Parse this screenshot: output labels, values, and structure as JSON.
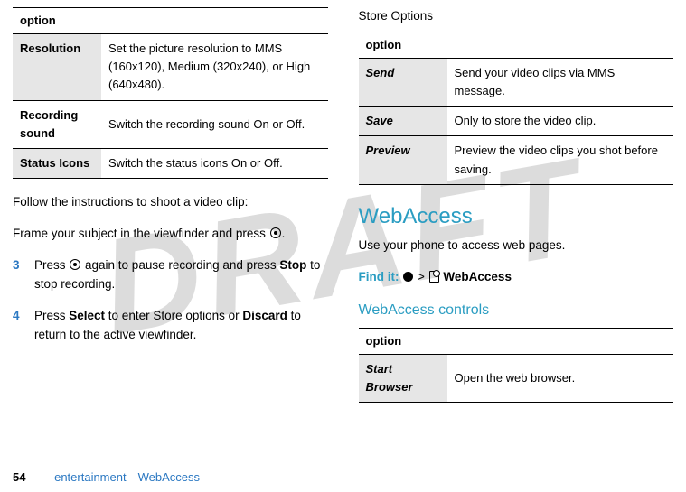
{
  "watermark": "DRAFT",
  "left": {
    "table1": {
      "header": "option",
      "rows": [
        {
          "name": "Resolution",
          "desc": "Set the picture resolution to MMS (160x120), Medium (320x240), or High (640x480).",
          "shade": true
        },
        {
          "name": "Recording sound",
          "desc": "Switch the recording sound On or Off.",
          "shade": false
        },
        {
          "name": "Status Icons",
          "desc": "Switch the status icons On or Off.",
          "shade": true
        }
      ]
    },
    "intro": "Follow the instructions to shoot a video clip:",
    "frame_a": "Frame your subject in the viewfinder and press ",
    "frame_b": ".",
    "step3_a": "Press ",
    "step3_b": " again to pause recording and press ",
    "step3_stop": "Stop",
    "step3_c": " to stop recording.",
    "step4_a": "Press ",
    "step4_select": "Select",
    "step4_b": " to enter Store options or ",
    "step4_discard": "Discard",
    "step4_c": " to return to the active viewfinder."
  },
  "right": {
    "storetitle": "Store Options",
    "table2": {
      "header": "option",
      "rows": [
        {
          "name": "Send",
          "desc": "Send your video clips via MMS message."
        },
        {
          "name": "Save",
          "desc": "Only to store the video clip."
        },
        {
          "name": "Preview",
          "desc": "Preview the video clips you shot before saving."
        }
      ]
    },
    "h1": "WebAccess",
    "intro": "Use your phone to access web pages.",
    "findit": "Find it:",
    "findpath_sep": " > ",
    "findpath_label": "WebAccess",
    "sub": "WebAccess controls",
    "table3": {
      "header": "option",
      "rows": [
        {
          "name": "Start Browser",
          "desc": "Open the web browser."
        }
      ]
    }
  },
  "footer": {
    "page": "54",
    "section": "entertainment—WebAccess"
  }
}
